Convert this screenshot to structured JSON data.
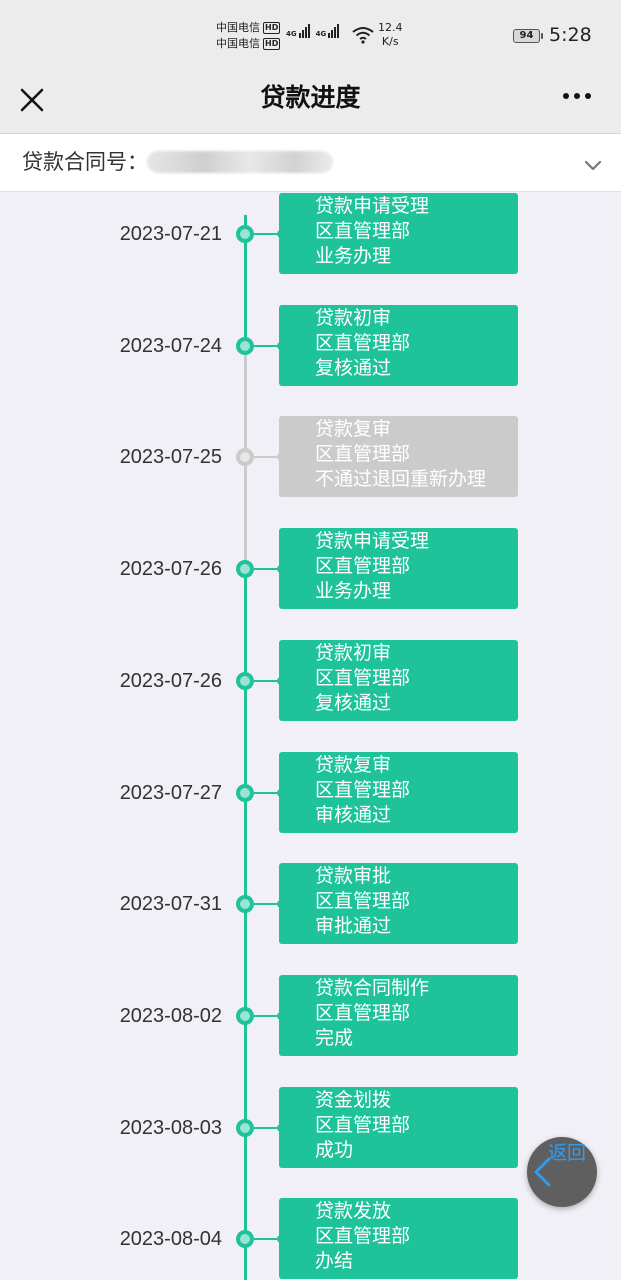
{
  "status_bar": {
    "carrier_1": "中国电信",
    "carrier_2": "中国电信",
    "hd_tag": "HD",
    "network_tag": "4G",
    "speed_value": "12.4",
    "speed_unit": "K/s",
    "battery": "94",
    "time": "5:28",
    "icons": [
      "signal-icon",
      "wifi-icon",
      "battery-icon"
    ]
  },
  "nav": {
    "title": "贷款进度",
    "close_icon": "close-icon",
    "more_icon": "more-icon"
  },
  "contract": {
    "label": "贷款合同号：",
    "value_blurred": true,
    "chevron_icon": "chevron-down-icon"
  },
  "colors": {
    "success": "#1fc39a",
    "rejected": "#cbcbcb",
    "page_bg": "#f1f0f6",
    "nav_bg": "#ececec",
    "fab_bg": "#5f5f5f",
    "fab_text": "#2f9cf0"
  },
  "timeline": [
    {
      "date": "2023-07-21",
      "step": "贷款申请受理",
      "dept": "区直管理部",
      "result": "业务办理",
      "status": "ok"
    },
    {
      "date": "2023-07-24",
      "step": "贷款初审",
      "dept": "区直管理部",
      "result": "复核通过",
      "status": "ok"
    },
    {
      "date": "2023-07-25",
      "step": "贷款复审",
      "dept": "区直管理部",
      "result": "不通过退回重新办理",
      "status": "fail"
    },
    {
      "date": "2023-07-26",
      "step": "贷款申请受理",
      "dept": "区直管理部",
      "result": "业务办理",
      "status": "ok"
    },
    {
      "date": "2023-07-26",
      "step": "贷款初审",
      "dept": "区直管理部",
      "result": "复核通过",
      "status": "ok"
    },
    {
      "date": "2023-07-27",
      "step": "贷款复审",
      "dept": "区直管理部",
      "result": "审核通过",
      "status": "ok"
    },
    {
      "date": "2023-07-31",
      "step": "贷款审批",
      "dept": "区直管理部",
      "result": "审批通过",
      "status": "ok"
    },
    {
      "date": "2023-08-02",
      "step": "贷款合同制作",
      "dept": "区直管理部",
      "result": "完成",
      "status": "ok"
    },
    {
      "date": "2023-08-03",
      "step": "资金划拨",
      "dept": "区直管理部",
      "result": "成功",
      "status": "ok"
    },
    {
      "date": "2023-08-04",
      "step": "贷款发放",
      "dept": "区直管理部",
      "result": "办结",
      "status": "ok"
    }
  ],
  "fab": {
    "label": "返回",
    "icon": "chevron-left-icon"
  }
}
